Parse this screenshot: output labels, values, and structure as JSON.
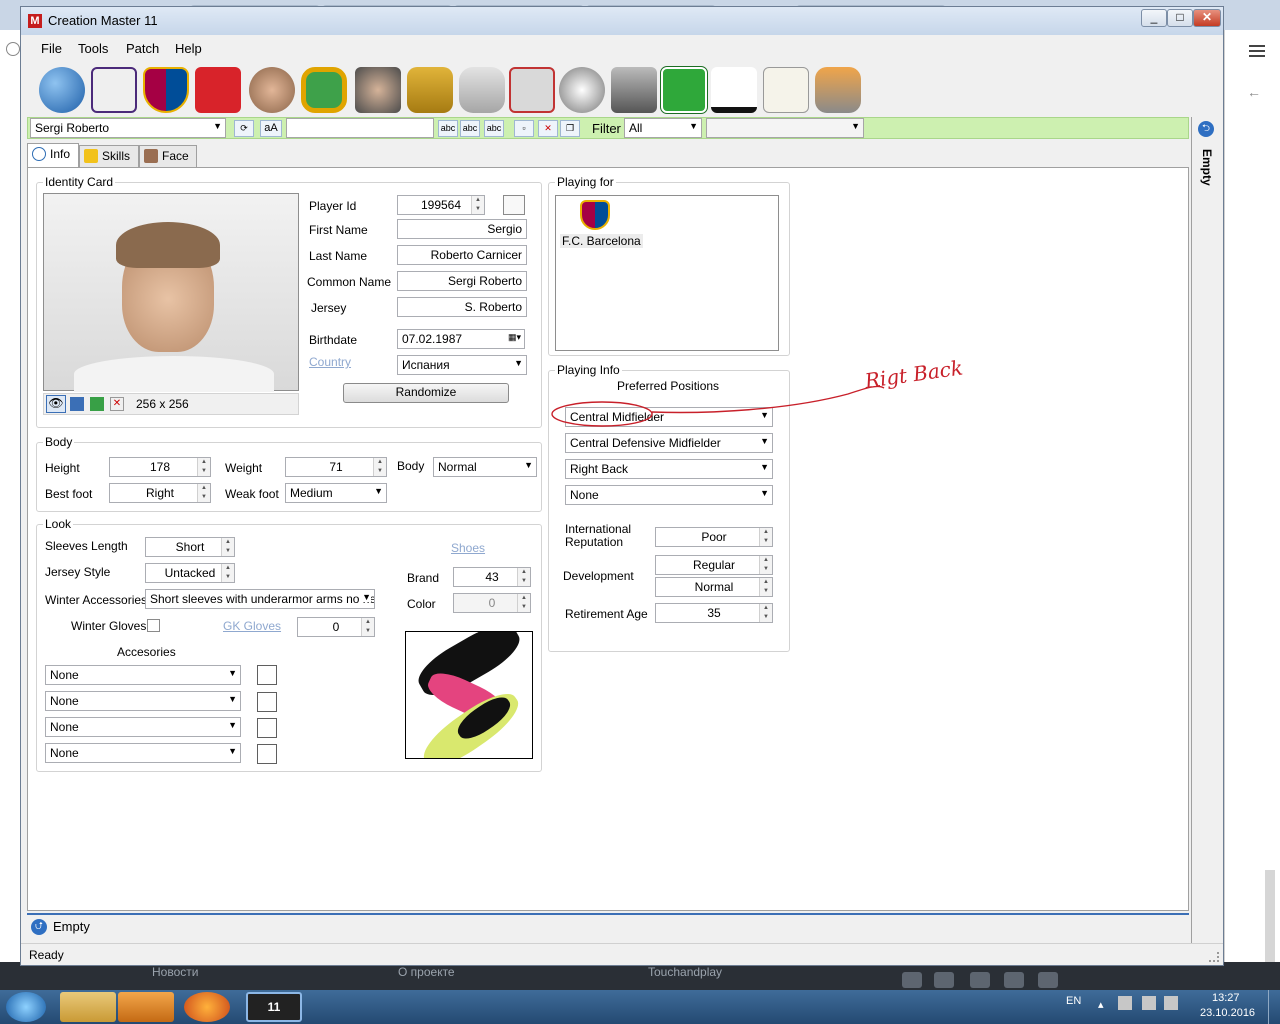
{
  "window": {
    "title": "Creation Master 11",
    "app_icon": "M",
    "min": "_",
    "max": "□",
    "close": "✕"
  },
  "menu": [
    "File",
    "Tools",
    "Patch",
    "Help"
  ],
  "toolbar_icons": [
    "globe-icon",
    "premier-league-icon",
    "barcelona-crest-icon",
    "kit-shirt-icon",
    "player-head-icon",
    "stadium-icon",
    "trophy-icon",
    "manager-icon",
    "trophies-icon",
    "gamepad-icon",
    "cards-icon",
    "ball-icon",
    "boots-icon",
    "pitch-icon",
    "nike-icon",
    "adidas-icon",
    "newspaper-icon",
    "gloves-icon"
  ],
  "selector": {
    "player": "Sergi Roberto",
    "case_btn": "aA",
    "filter_label": "Filter",
    "filter_value": "All",
    "abc": "abc"
  },
  "tabs": [
    "Info",
    "Skills",
    "Face"
  ],
  "identity": {
    "title": "Identity Card",
    "player_id_label": "Player Id",
    "player_id": "199564",
    "first_name_label": "First Name",
    "first_name": "Sergio",
    "last_name_label": "Last Name",
    "last_name": "Roberto Carnicer",
    "common_name_label": "Common Name",
    "common_name": "Sergi Roberto",
    "jersey_label": "Jersey",
    "jersey": "S. Roberto",
    "birthdate_label": "Birthdate",
    "birthdate": "07.02.1987",
    "country_label": "Country",
    "country": "Испания",
    "randomize": "Randomize",
    "photo_size": "256 x 256"
  },
  "body": {
    "title": "Body",
    "height_label": "Height",
    "height": "178",
    "weight_label": "Weight",
    "weight": "71",
    "body_label": "Body",
    "body": "Normal",
    "best_foot_label": "Best foot",
    "best_foot": "Right",
    "weak_foot_label": "Weak foot",
    "weak_foot": "Medium"
  },
  "look": {
    "title": "Look",
    "sleeves_label": "Sleeves Length",
    "sleeves": "Short",
    "jersey_style_label": "Jersey Style",
    "jersey_style": "Untacked",
    "winter_acc_label": "Winter Accessories",
    "winter_acc": "Short sleeves with underarmor arms no neck",
    "winter_gloves_label": "Winter Gloves",
    "gk_gloves_label": "GK Gloves",
    "gk_gloves": "0",
    "accessories_label": "Accesories",
    "accessories": [
      "None",
      "None",
      "None",
      "None"
    ],
    "shoes_label": "Shoes",
    "brand_label": "Brand",
    "brand": "43",
    "color_label": "Color",
    "color": "0"
  },
  "playing_for": {
    "title": "Playing for",
    "club": "F.C. Barcelona"
  },
  "playing_info": {
    "title": "Playing Info",
    "pref_positions_label": "Preferred Positions",
    "positions": [
      "Central Midfielder",
      "Central Defensive Midfielder",
      "Right Back",
      "None"
    ],
    "intl_rep_label": "International Reputation",
    "intl_rep": "Poor",
    "development_label": "Development",
    "development_1": "Regular",
    "development_2": "Normal",
    "retirement_label": "Retirement Age",
    "retirement": "35"
  },
  "annotation": {
    "text": "Rigt Back",
    "color": "#c8202a"
  },
  "side_panel": {
    "label": "Empty"
  },
  "bottom_panel": {
    "label": "Empty"
  },
  "status": "Ready",
  "browser_bottom": [
    "Новости",
    "О проекте",
    "Touchandplay"
  ],
  "taskbar": {
    "lang": "EN",
    "time": "13:27",
    "date": "23.10.2016",
    "cm_label": "11"
  }
}
